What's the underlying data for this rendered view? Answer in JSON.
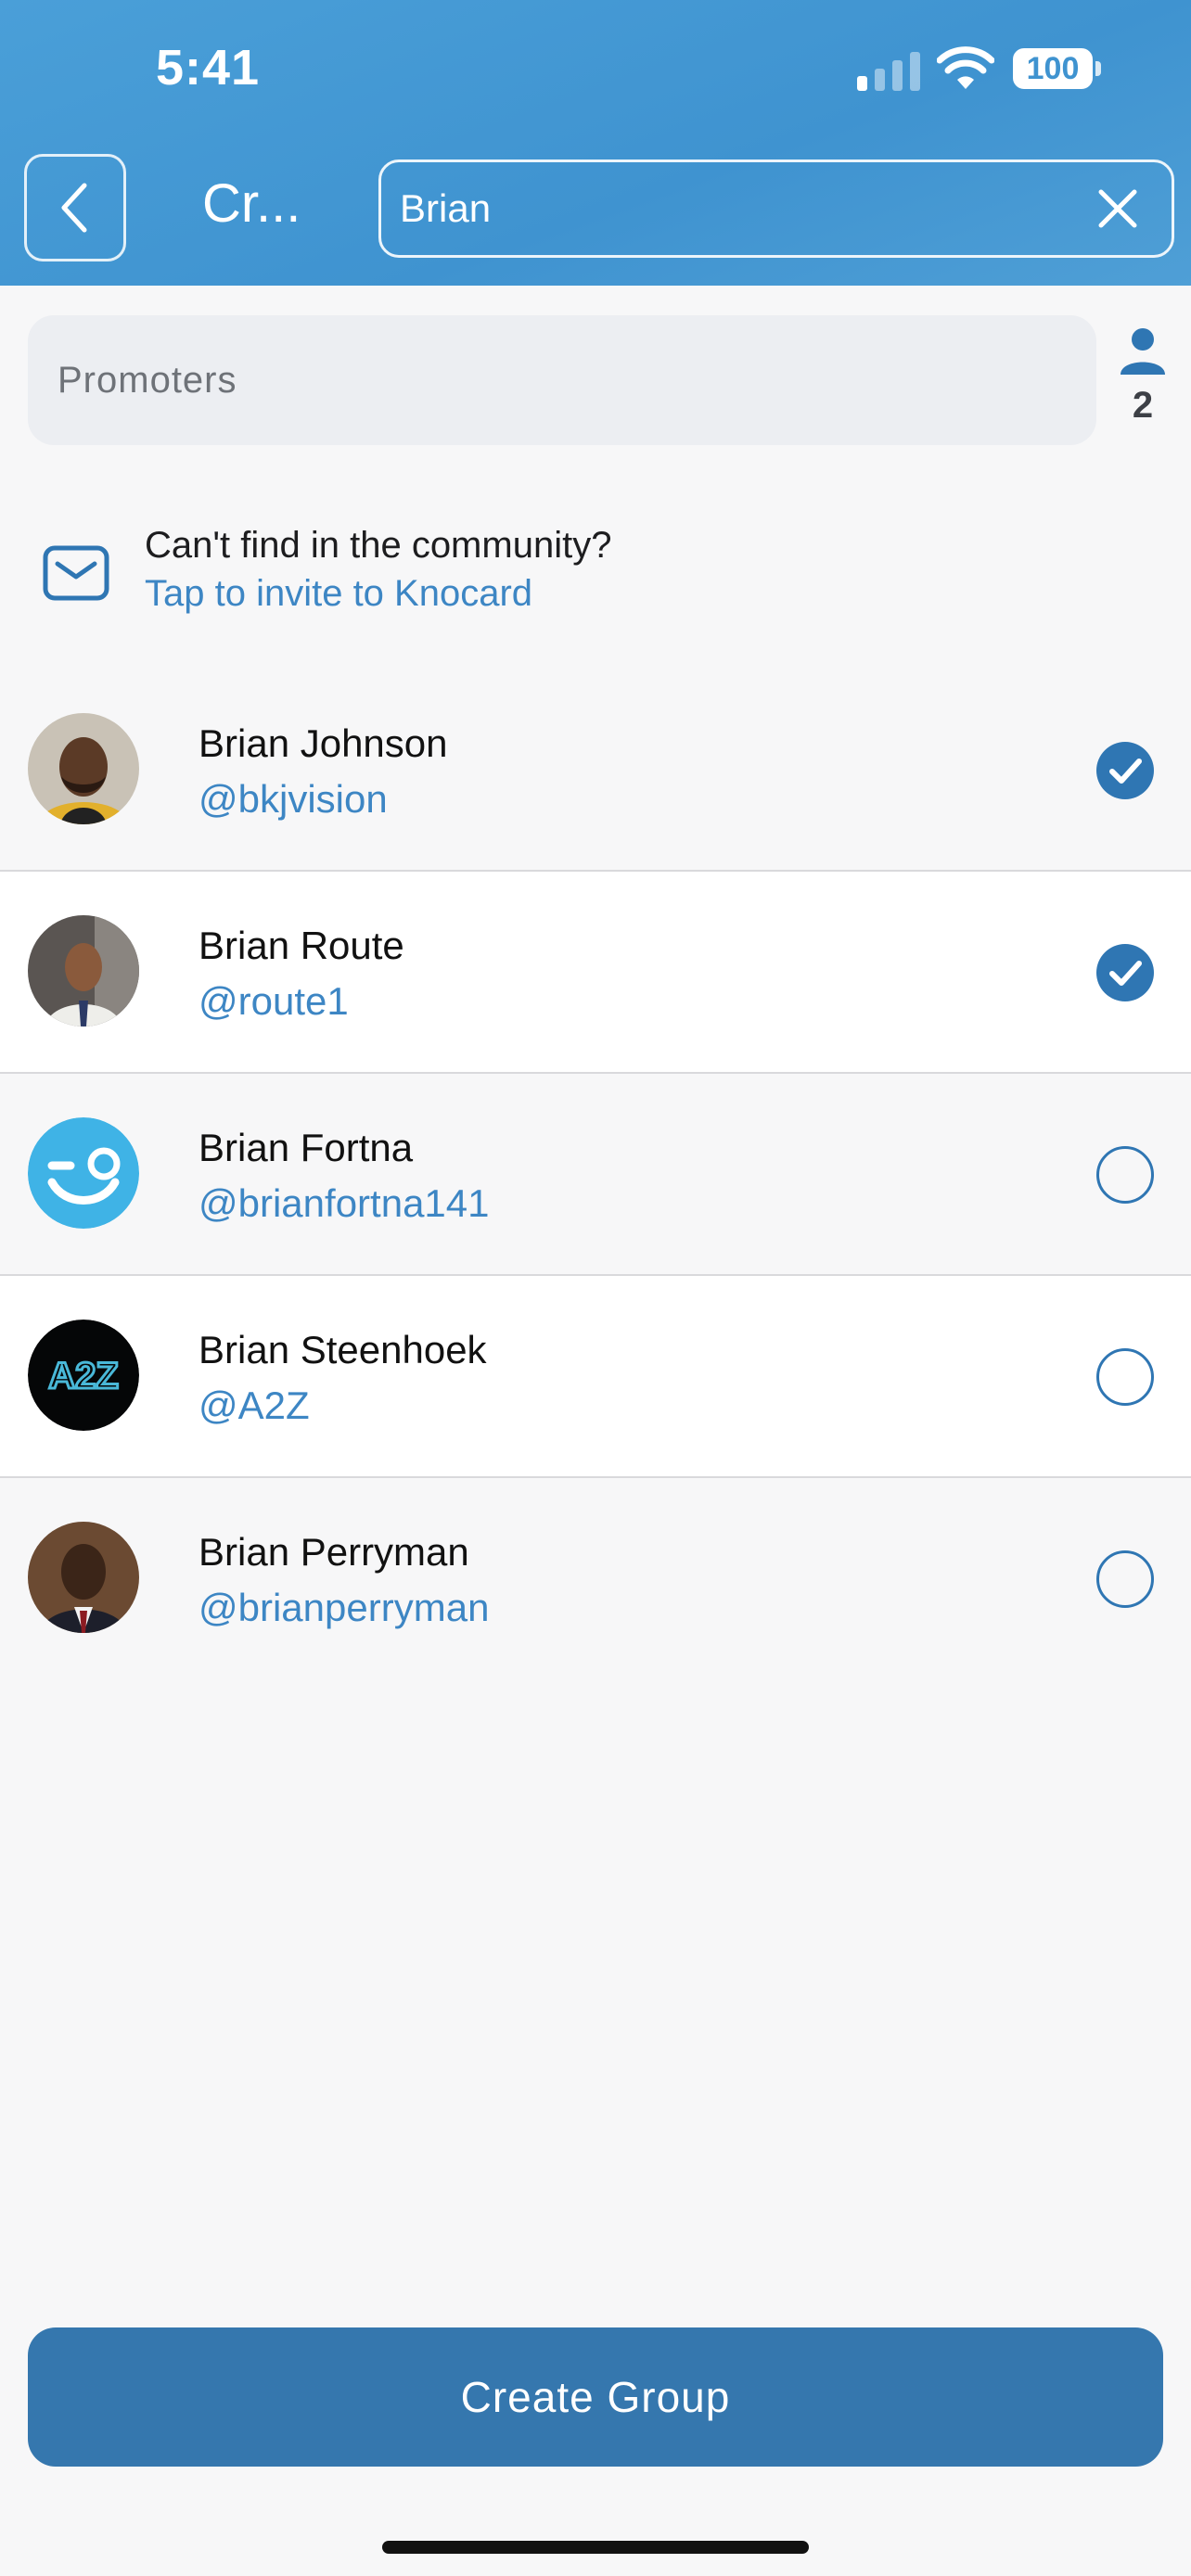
{
  "status": {
    "time": "5:41",
    "battery": "100"
  },
  "header": {
    "title": "Cr...",
    "search_value": "Brian"
  },
  "group": {
    "name_placeholder": "Promoters",
    "member_count": "2"
  },
  "invite": {
    "question": "Can't find in the community?",
    "link": "Tap to invite to Knocard"
  },
  "contacts": [
    {
      "name": "Brian Johnson",
      "handle": "@bkjvision",
      "selected": true
    },
    {
      "name": "Brian Route",
      "handle": "@route1",
      "selected": true
    },
    {
      "name": "Brian Fortna",
      "handle": "@brianfortna141",
      "selected": false
    },
    {
      "name": "Brian Steenhoek",
      "handle": "@A2Z",
      "selected": false
    },
    {
      "name": "Brian Perryman",
      "handle": "@brianperryman",
      "selected": false
    }
  ],
  "avatar_logo_text": "A2Z",
  "footer": {
    "create_label": "Create Group"
  },
  "colors": {
    "header": "#3f93d0",
    "accent": "#2f76b3",
    "link": "#3d86c4",
    "button": "#3577ae"
  }
}
